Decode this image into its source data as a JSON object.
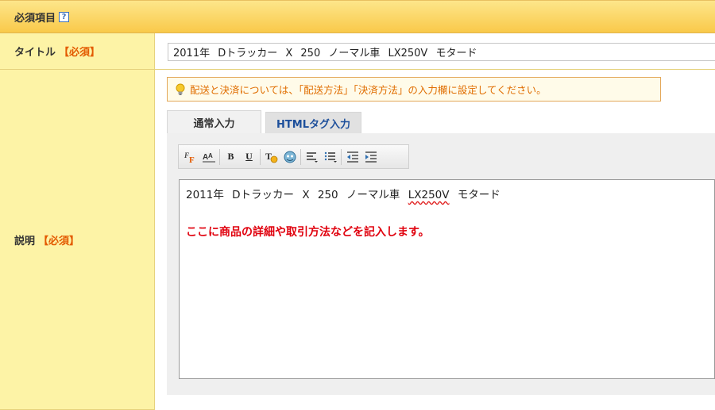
{
  "section": {
    "title": "必須項目",
    "help_icon": "?"
  },
  "title_row": {
    "label": "タイトル",
    "required": "【必須】",
    "value": "2011年 Dトラッカー X 250 ノーマル車 LX250V モタード"
  },
  "description_row": {
    "label": "説明",
    "required": "【必須】",
    "notice": "配送と決済については、「配送方法」「決済方法」の入力欄に設定してください。",
    "tabs": [
      {
        "label": "通常入力"
      },
      {
        "label": "HTMLタグ入力"
      }
    ],
    "toolbar": {
      "font_btn": "F",
      "size_btn": "A",
      "bold_btn": "B",
      "underline_btn": "U",
      "color_btn": "T"
    },
    "editor": {
      "line1_prefix": "2011年 Dトラッカー X 250 ノーマル車",
      "line1_model": "LX250V",
      "line1_suffix": "モタード",
      "line2": "ここに商品の詳細や取引方法などを記入します。"
    }
  },
  "colors": {
    "header_bg": "#f9c94a",
    "label_bg": "#fdf3a6",
    "required": "#e35a00",
    "notice_text": "#e06d00",
    "tab_html_text": "#1d4f9b",
    "placeholder_red": "#e0000d"
  }
}
